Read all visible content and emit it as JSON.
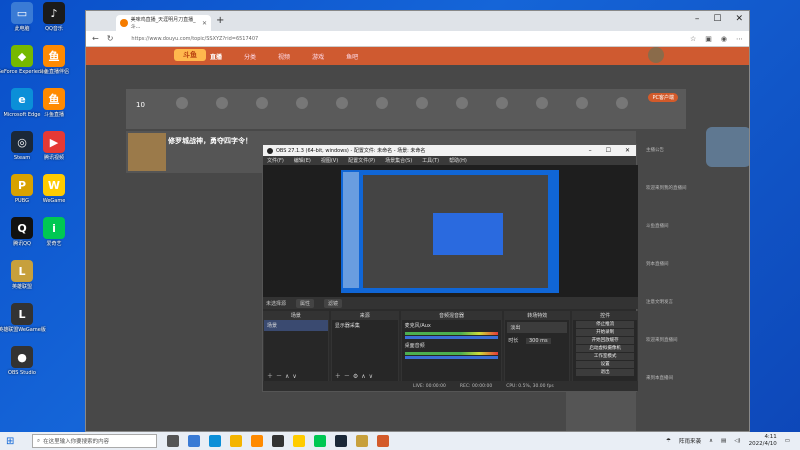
{
  "desktop": {
    "icons": [
      {
        "label": "此电脑",
        "color": "#3a7bd5",
        "glyph": "▭"
      },
      {
        "label": "QQ音乐",
        "color": "#1b1b1b",
        "glyph": "♪"
      },
      {
        "label": "GeForce Experience",
        "color": "#76b900",
        "glyph": "◆"
      },
      {
        "label": "斗鱼直播伴侣",
        "color": "#ff8a00",
        "glyph": "鱼"
      },
      {
        "label": "Microsoft Edge",
        "color": "#0b8fd8",
        "glyph": "e"
      },
      {
        "label": "斗鱼直播",
        "color": "#ff8a00",
        "glyph": "鱼"
      },
      {
        "label": "Steam",
        "color": "#1b2838",
        "glyph": "◎"
      },
      {
        "label": "腾讯视频",
        "color": "#e53935",
        "glyph": "▶"
      },
      {
        "label": "PUBG",
        "color": "#d8a200",
        "glyph": "P"
      },
      {
        "label": "WeGame",
        "color": "#ffcc00",
        "glyph": "W"
      },
      {
        "label": "腾讯QQ",
        "color": "#111111",
        "glyph": "Q"
      },
      {
        "label": "爱奇艺",
        "color": "#00c853",
        "glyph": "i"
      },
      {
        "label": "英雄联盟",
        "color": "#c7a03c",
        "glyph": "L"
      },
      {
        "label": "英雄联盟WeGame版",
        "color": "#333333",
        "glyph": "L"
      },
      {
        "label": "OBS Studio",
        "color": "#333333",
        "glyph": "●"
      }
    ]
  },
  "browser": {
    "tab_title": "美味鸡直播_天涯明月刀直播_斗...",
    "url": "https://www.douyu.com/topic/SSXYZ?rid=6517407",
    "nav_items": [
      "首页",
      "直播",
      "分类",
      "视频",
      "游戏",
      "鱼吧"
    ],
    "active_nav": "直播",
    "logo_text": "斗鱼",
    "level_number": "10",
    "pc_badge": "PC客户端",
    "stream_title": "修罗城战神，勇夺四字令！",
    "chat_lines": [
      "主播公告",
      "欢迎来到我的直播间",
      "斗鱼直播间",
      "到本直播间",
      "注意文明发言",
      "欢迎来到直播间",
      "来到本直播间"
    ]
  },
  "obs": {
    "title": "OBS 27.1.3 (64-bit, windows) - 配置文件: 未命名 - 场景: 未命名",
    "menu": [
      "文件(F)",
      "编辑(E)",
      "视图(V)",
      "配置文件(P)",
      "场景集合(S)",
      "工具(T)",
      "帮助(H)"
    ],
    "scene_bar_label": "未选择源",
    "scene_bar_props": "属性",
    "scene_bar_filters": "滤镜",
    "docks": {
      "scenes_header": "场景",
      "sources_header": "来源",
      "mixer_header": "音频混音器",
      "transitions_header": "转场特效",
      "controls_header": "控件",
      "scene_item": "场景",
      "source_item": "显示器采集",
      "mixer_tracks": [
        "麦克风/Aux",
        "桌面音频"
      ],
      "transition_value": "淡出",
      "duration_label": "时长",
      "duration_value": "300 ms",
      "controls": [
        "停止推流",
        "开始录制",
        "开始回放缓存",
        "启动虚拟摄像机",
        "工作室模式",
        "设置",
        "退出"
      ]
    },
    "status": [
      "LIVE: 00:00:00",
      "REC: 00:00:00",
      "CPU: 0.5%, 30.00 fps"
    ]
  },
  "taskbar": {
    "search_placeholder": "在这里输入你要搜索的内容",
    "weather": "阵雨来袭",
    "time": "4:11",
    "date": "2022/4/10"
  }
}
